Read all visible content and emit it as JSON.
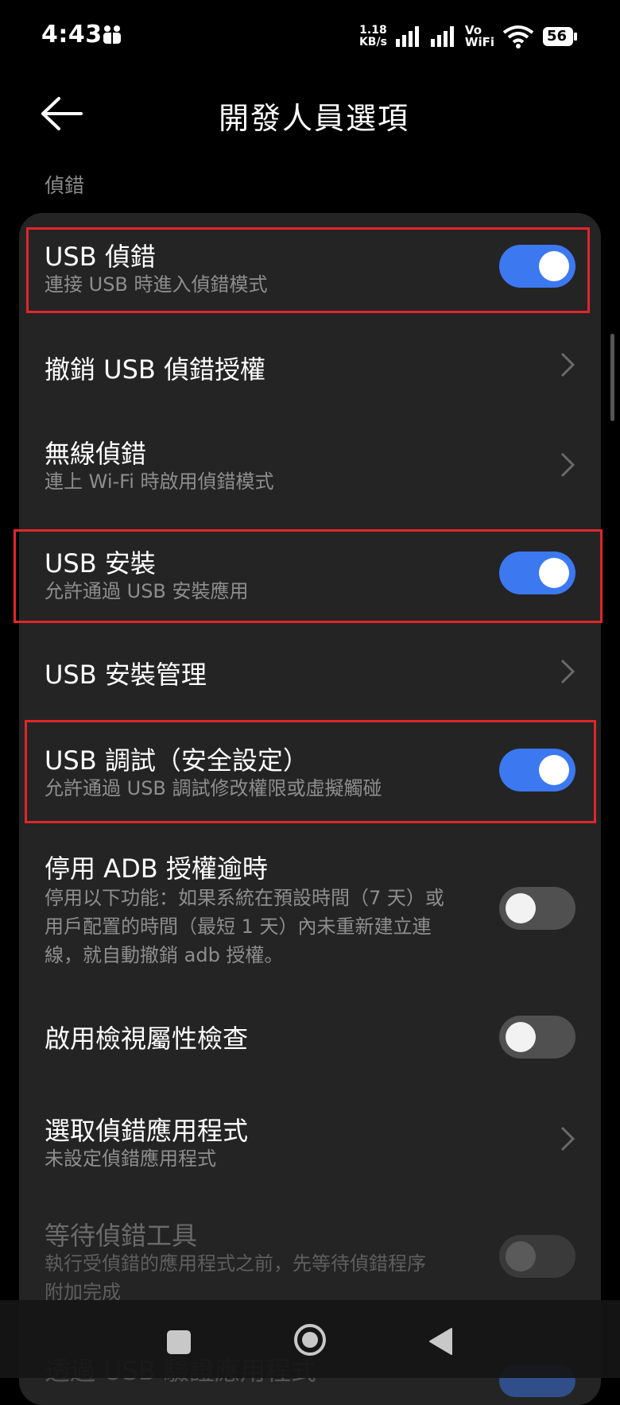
{
  "status_bar": {
    "time": "4:43",
    "net_speed_value": "1.18",
    "net_speed_unit": "KB/s",
    "vo": "Vo",
    "wifi_label": "WiFi",
    "battery": "56"
  },
  "header": {
    "title": "開發人員選項"
  },
  "section": {
    "label": "偵錯"
  },
  "items": [
    {
      "title": "USB 偵錯",
      "subtitle": "連接 USB 時進入偵錯模式",
      "control": "toggle",
      "state": "on"
    },
    {
      "title": "撤銷 USB 偵錯授權",
      "control": "chevron"
    },
    {
      "title": "無線偵錯",
      "subtitle": "連上 Wi-Fi 時啟用偵錯模式",
      "control": "chevron"
    },
    {
      "title": "USB 安裝",
      "subtitle": "允許通過 USB 安裝應用",
      "control": "toggle",
      "state": "on"
    },
    {
      "title": "USB 安裝管理",
      "control": "chevron"
    },
    {
      "title": "USB 調試（安全設定）",
      "subtitle": "允許通過 USB 調試修改權限或虛擬觸碰",
      "control": "toggle",
      "state": "on"
    },
    {
      "title": "停用 ADB 授權逾時",
      "subtitle_lines": [
        "停用以下功能：如果系統在預設時間（7 天）或",
        "用戶配置的時間（最短 1 天）內未重新建立連",
        "線，就自動撤銷 adb 授權。"
      ],
      "control": "toggle",
      "state": "off"
    },
    {
      "title": "啟用檢視屬性檢查",
      "control": "toggle",
      "state": "off"
    },
    {
      "title": "選取偵錯應用程式",
      "subtitle": "未設定偵錯應用程式",
      "control": "chevron"
    },
    {
      "title": "等待偵錯工具",
      "subtitle_lines": [
        "執行受偵錯的應用程式之前，先等待偵錯程序",
        "附加完成"
      ],
      "control": "toggle",
      "state": "disabled"
    },
    {
      "title": "透過 USB 驗證應用程式",
      "control": "toggle",
      "state": "on"
    }
  ],
  "colors": {
    "toggle_on": "#3c78f0",
    "highlight_box": "#e0262b",
    "card_bg": "#242424"
  },
  "icons": [
    "back-arrow-icon",
    "chevron-right-icon",
    "recent-apps-icon",
    "home-icon",
    "nav-back-icon",
    "wifi-icon",
    "signal-icon",
    "battery-icon"
  ]
}
